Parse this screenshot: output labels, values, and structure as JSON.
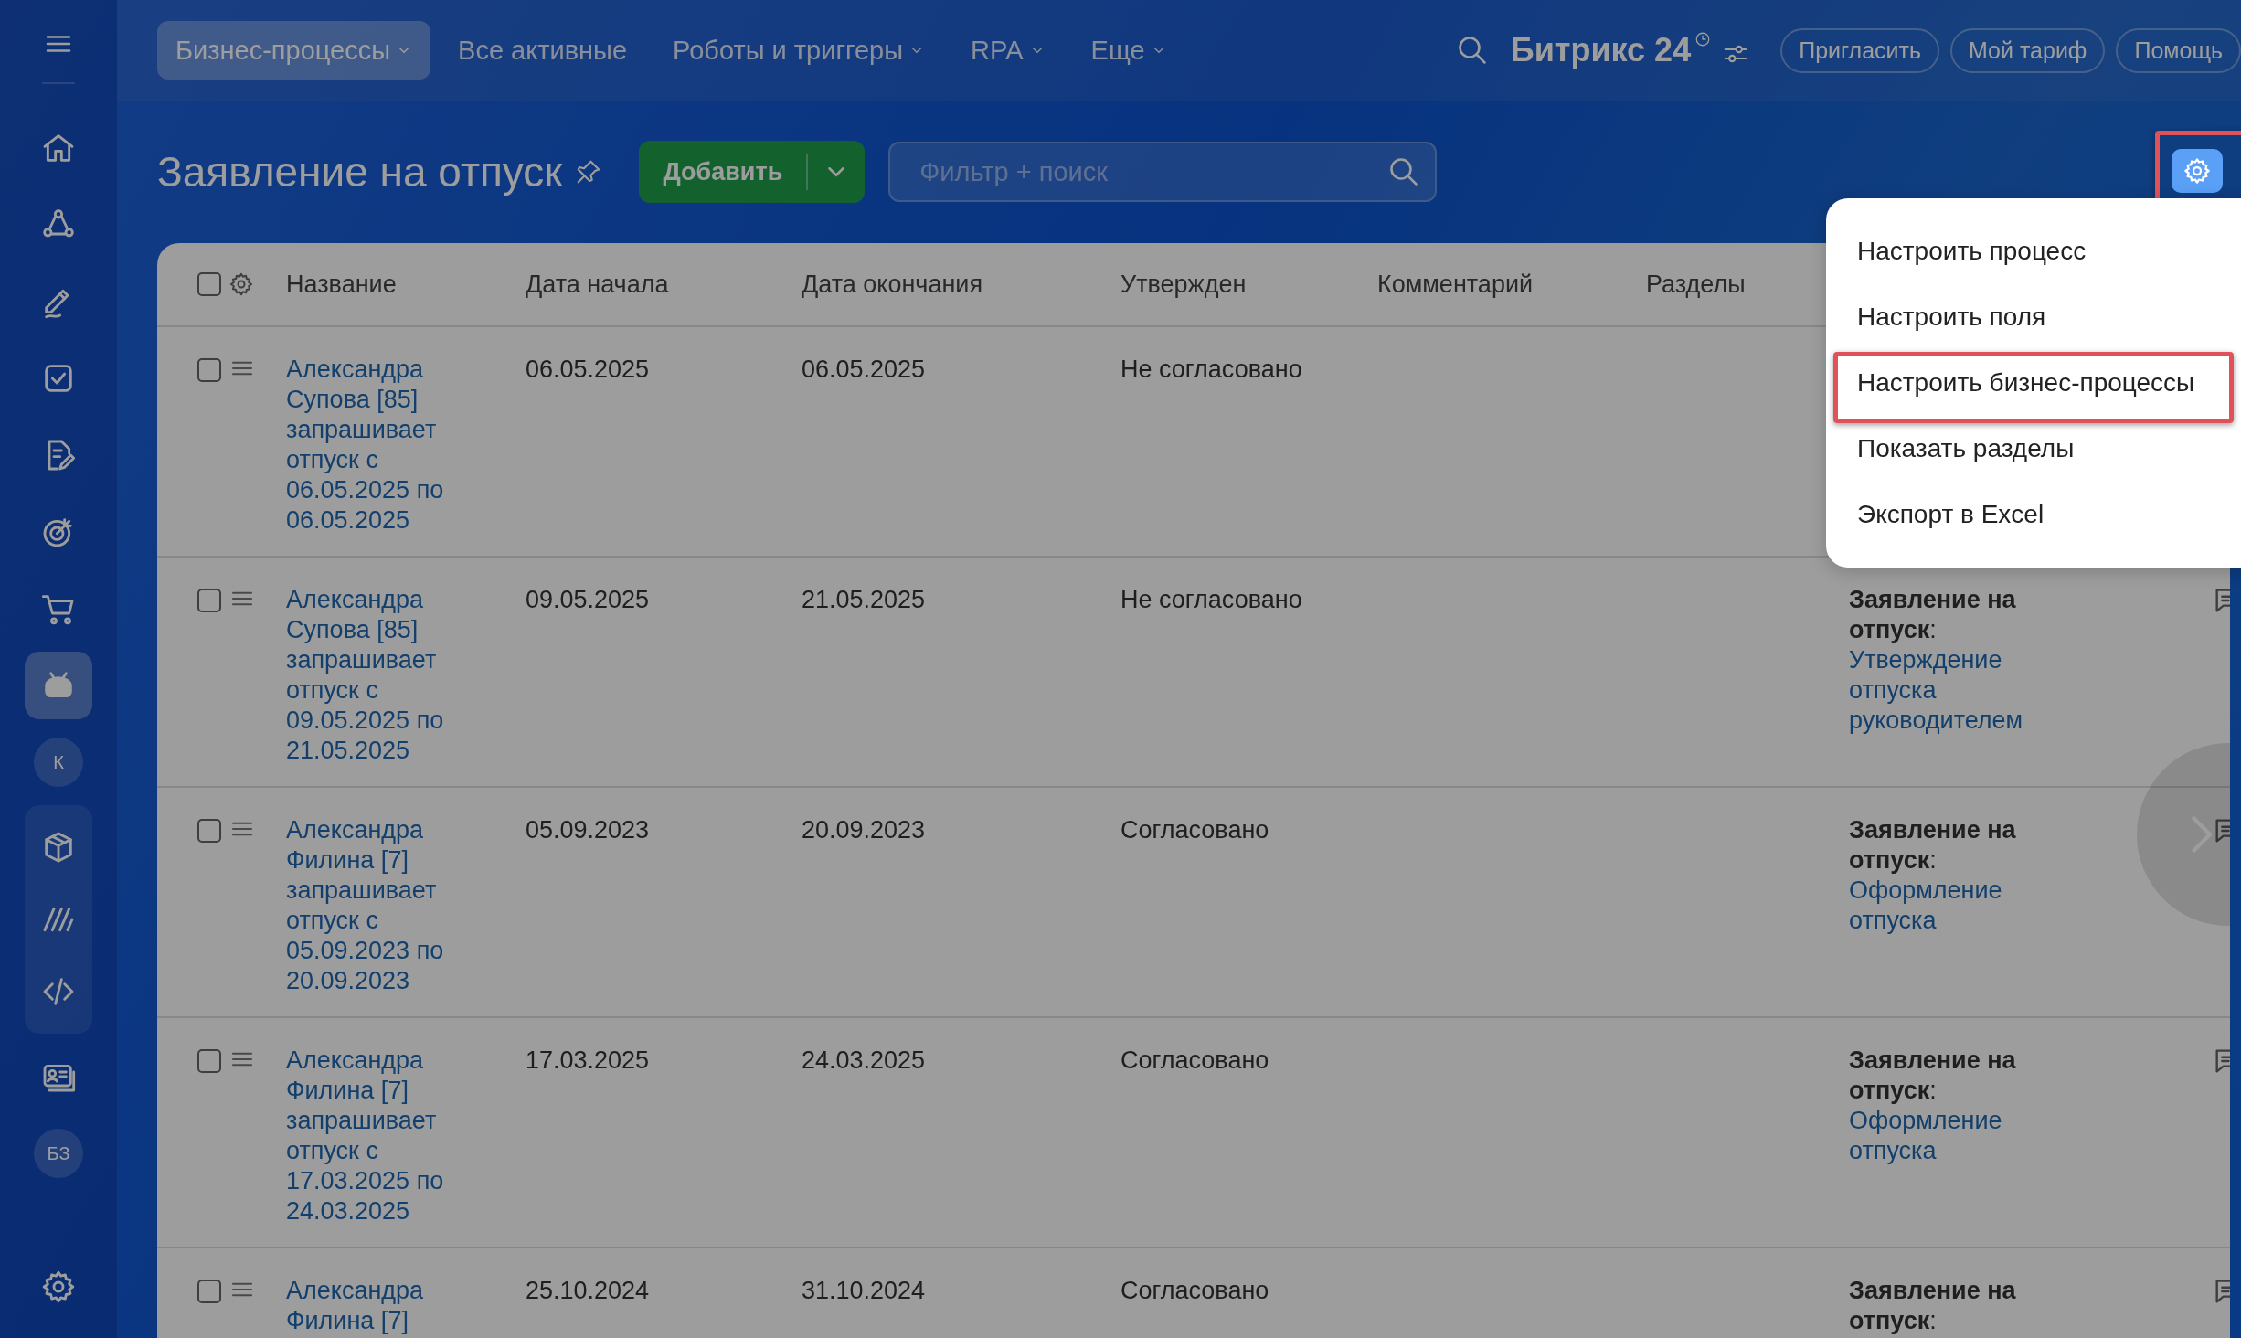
{
  "top_nav": {
    "tabs": [
      {
        "label": "Бизнес-процессы",
        "selected": true,
        "dropdown": true
      },
      {
        "label": "Все активные",
        "selected": false,
        "dropdown": false
      },
      {
        "label": "Роботы и триггеры",
        "selected": false,
        "dropdown": true
      },
      {
        "label": "RPA",
        "selected": false,
        "dropdown": true
      },
      {
        "label": "Еще",
        "selected": false,
        "dropdown": true
      }
    ],
    "logo": "Битрикс 24",
    "buttons": [
      "Пригласить",
      "Мой тариф",
      "Помощь"
    ]
  },
  "sidebar": {
    "items": [
      {
        "kind": "icon",
        "selected": false
      },
      {
        "kind": "icon",
        "selected": false
      },
      {
        "kind": "icon",
        "selected": false
      },
      {
        "kind": "icon",
        "selected": false
      },
      {
        "kind": "icon",
        "selected": false
      },
      {
        "kind": "icon",
        "selected": false
      },
      {
        "kind": "icon",
        "selected": false
      },
      {
        "kind": "icon",
        "selected": true
      },
      {
        "kind": "avatar",
        "label": "К"
      },
      {
        "kind": "group",
        "items": [
          {
            "kind": "icon",
            "selected": false
          },
          {
            "kind": "icon",
            "selected": false
          },
          {
            "kind": "icon",
            "selected": false
          }
        ]
      },
      {
        "kind": "icon",
        "selected": false
      },
      {
        "kind": "avatar",
        "label": "БЗ"
      }
    ]
  },
  "page": {
    "title": "Заявление на отпуск",
    "add_button": "Добавить",
    "search": {
      "placeholder": "Фильтр + поиск"
    },
    "settings_button": {
      "highlighted": true
    }
  },
  "table": {
    "select_all": {
      "checked": false
    },
    "columns": [
      "Название",
      "Дата начала",
      "Дата окончания",
      "Утвержден",
      "Комментарий",
      "Разделы"
    ],
    "rows": [
      {
        "checked": false,
        "name": "Александра Супова [85] запрашивает отпуск с 06.05.2025 по 06.05.2025",
        "start": "06.05.2025",
        "end": "06.05.2025",
        "approved": "Не согласовано",
        "comment_icon": false
      },
      {
        "checked": false,
        "name": "Александра Супова [85] запрашивает отпуск с 09.05.2025 по 21.05.2025",
        "start": "09.05.2025",
        "end": "21.05.2025",
        "approved": "Не согласовано",
        "process": {
          "title": "**Заявление на отпуск**:",
          "stage": "Утверждение отпуска руководителем"
        },
        "comment_icon": true
      },
      {
        "checked": false,
        "name": "Александра Филина [7] запрашивает отпуск с 05.09.2023 по 20.09.2023",
        "start": "05.09.2023",
        "end": "20.09.2023",
        "approved": "Согласовано",
        "process": {
          "title": "**Заявление на отпуск**:",
          "stage": "Оформление отпуска"
        },
        "comment_icon": true
      },
      {
        "checked": false,
        "name": "Александра Филина [7] запрашивает отпуск с 17.03.2025 по 24.03.2025",
        "start": "17.03.2025",
        "end": "24.03.2025",
        "approved": "Согласовано",
        "process": {
          "title": "**Заявление на отпуск**:",
          "stage": "Оформление отпуска"
        },
        "comment_icon": true
      },
      {
        "checked": false,
        "name": "Александра Филина [7]",
        "start": "25.10.2024",
        "end": "31.10.2024",
        "approved": "Согласовано",
        "process": {
          "title": "**Заявление на отпуск**:"
        },
        "comment_icon": true
      }
    ]
  },
  "settings_menu": {
    "items": [
      {
        "label": "Настроить процесс",
        "highlighted": false
      },
      {
        "label": "Настроить поля",
        "highlighted": false
      },
      {
        "label": "Настроить бизнес-процессы",
        "highlighted": true
      },
      {
        "label": "Показать разделы",
        "highlighted": false
      },
      {
        "label": "Экспорт в Excel",
        "highlighted": false
      }
    ]
  }
}
